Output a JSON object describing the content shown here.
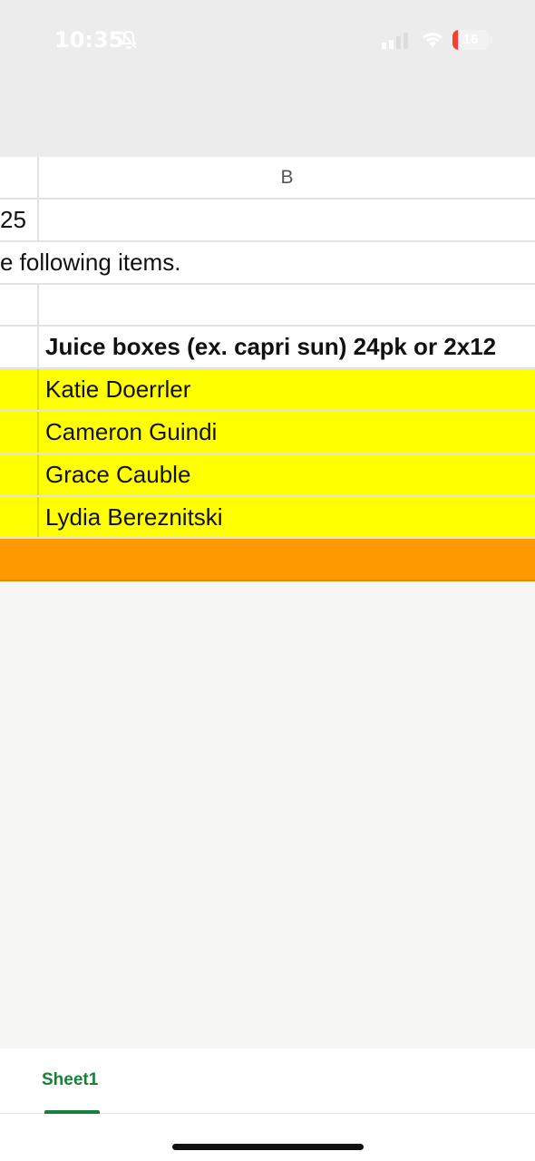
{
  "status_bar": {
    "time": "10:35",
    "battery_level": "16",
    "battery_fraction": 0.16,
    "accent_color": "#ff3b30",
    "icons": [
      "bell-slash-icon",
      "signal-icon",
      "wifi-icon",
      "battery-icon"
    ]
  },
  "spreadsheet": {
    "column_header": "B",
    "rows": [
      {
        "a": "25",
        "b": ""
      },
      {
        "a": "e following items.",
        "b": ""
      },
      {
        "a": "",
        "b": ""
      },
      {
        "a": "",
        "b": "Juice boxes (ex. capri sun) 24pk or 2x12"
      },
      {
        "a": "",
        "b": "Katie Doerrler"
      },
      {
        "a": "",
        "b": "Cameron Guindi"
      },
      {
        "a": "",
        "b": "Grace Cauble"
      },
      {
        "a": "",
        "b": "Lydia Bereznitski"
      },
      {
        "a": "",
        "b": ""
      }
    ],
    "colors": {
      "highlight_yellow": "#ffff00",
      "highlight_orange": "#ff9900"
    }
  },
  "sheet_tabs": [
    {
      "label": "Sheet1",
      "active": true
    }
  ],
  "tab_accent_color": "#188038"
}
